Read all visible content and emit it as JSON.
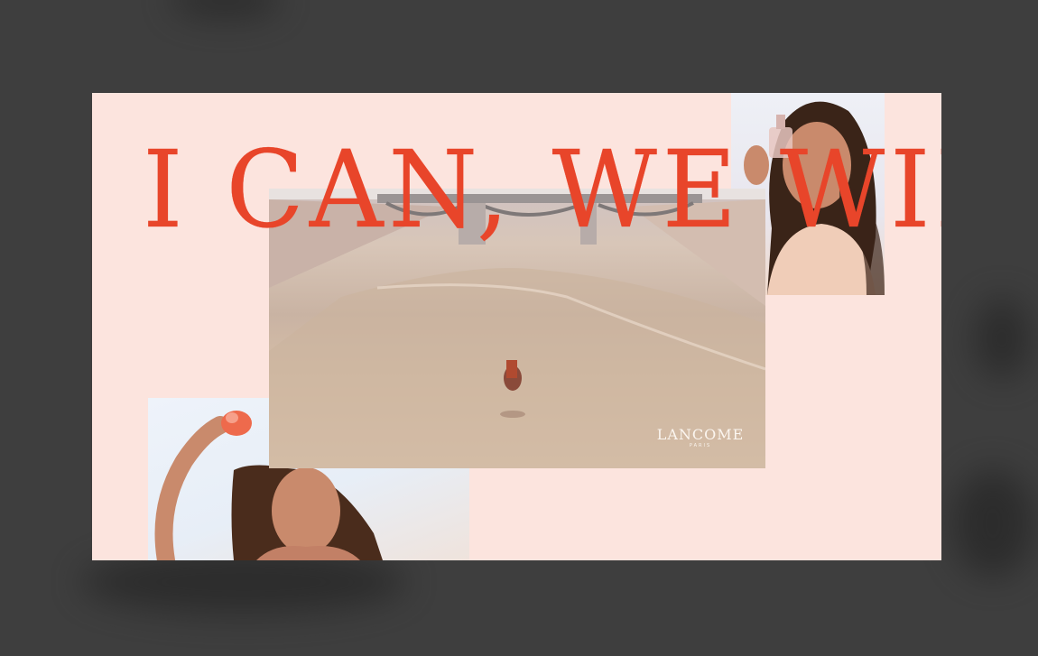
{
  "slide": {
    "headline": "I CAN, WE WILL",
    "brand_name": "LANCOME",
    "brand_sub": "PARIS"
  },
  "colors": {
    "backdrop": "#3e3e3e",
    "slide_background": "#fce4de",
    "headline": "#e8452a"
  },
  "images": {
    "video": "aerial-horse-rider-river-bridge",
    "portrait_top": "woman-holding-perfume-bottle",
    "portrait_bottom": "woman-raising-perfume-bottle"
  }
}
